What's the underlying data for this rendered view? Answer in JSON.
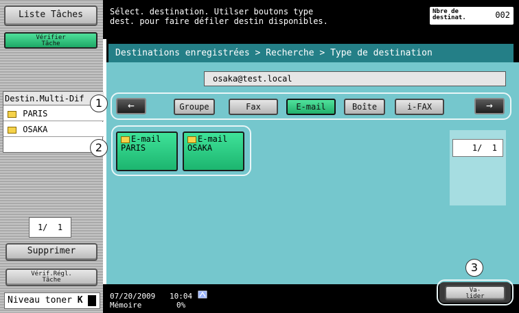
{
  "left": {
    "task_list_label": "Liste Tâches",
    "verify_task_label": "Vérifier\nTâche",
    "multi_dest_title": "Destin.Multi-Dif",
    "destinations": [
      {
        "label": "PARIS"
      },
      {
        "label": "OSAKA"
      }
    ],
    "page_counter": "1/  1",
    "delete_label": "Supprimer",
    "verify_settings_label": "Vérif.Régl.\nTâche",
    "toner_label": "Niveau toner",
    "toner_glyph": "K"
  },
  "top": {
    "instruction_line1": "Sélect. destination. Utilser boutons type",
    "instruction_line2": "dest. pour faire défiler destin disponibles.",
    "dest_count_label": "Nbre de\ndestinat.",
    "dest_count_value": "002"
  },
  "main": {
    "breadcrumb": "Destinations enregistrées > Recherche > Type de destination",
    "search_value": "osaka@test.local",
    "tabs": [
      "Groupe",
      "Fax",
      "E-mail",
      "Boîte",
      "i-FAX"
    ],
    "active_tab": "E-mail",
    "left_arrow": "←",
    "right_arrow": "→",
    "dest_buttons": [
      {
        "type": "E-mail",
        "name": "PARIS"
      },
      {
        "type": "E-mail",
        "name": "OSAKA"
      }
    ],
    "page_indicator": "1/  1"
  },
  "callouts": [
    "1",
    "2",
    "3"
  ],
  "bottom": {
    "date": "07/20/2009",
    "time": "10:04",
    "memory_label": "Mémoire",
    "memory_value": "0%",
    "validate_label": "Va-\nlider"
  },
  "colors": {
    "main_bg": "#75c7cd",
    "active_green": "#22b06c",
    "panel_gray": "#bfbfbf"
  },
  "icons": {
    "envelope": "envelope-icon",
    "network": "network-icon"
  }
}
